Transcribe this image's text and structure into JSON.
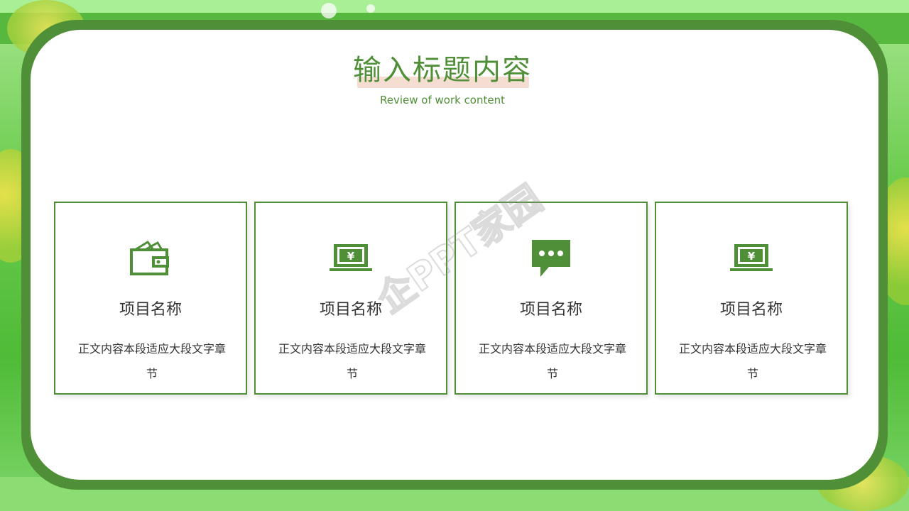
{
  "title": "输入标题内容",
  "subtitle": "Review of work content",
  "watermark": "企PPT家园",
  "colors": {
    "accent": "#4f8f37",
    "text": "#333333",
    "highlight": "#f5ddd2"
  },
  "cards": [
    {
      "icon": "wallet-icon",
      "name": "项目名称",
      "body": "正文内容本段适应大段文字章节"
    },
    {
      "icon": "laptop-yen-icon",
      "name": "项目名称",
      "body": "正文内容本段适应大段文字章节"
    },
    {
      "icon": "chat-bubble-icon",
      "name": "项目名称",
      "body": "正文内容本段适应大段文字章节"
    },
    {
      "icon": "laptop-yen-icon",
      "name": "项目名称",
      "body": "正文内容本段适应大段文字章节"
    }
  ]
}
